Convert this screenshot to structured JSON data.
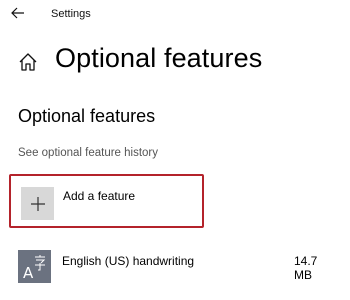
{
  "window": {
    "title": "Settings"
  },
  "header": {
    "page_title": "Optional features"
  },
  "main": {
    "section_title": "Optional features",
    "history_link": "See optional feature history",
    "add_feature": {
      "label": "Add a feature"
    },
    "features": [
      {
        "name": "English (US) handwriting",
        "size": "14.7 MB"
      }
    ]
  },
  "icons": {
    "back": "back-arrow-icon",
    "home": "home-icon",
    "add": "plus-icon",
    "language": "language-character-icon"
  },
  "colors": {
    "highlight_border": "#b4232b",
    "add_tile_bg": "#d8d8d8",
    "feature_tile_bg": "#6b7280",
    "link_text": "#555555"
  }
}
